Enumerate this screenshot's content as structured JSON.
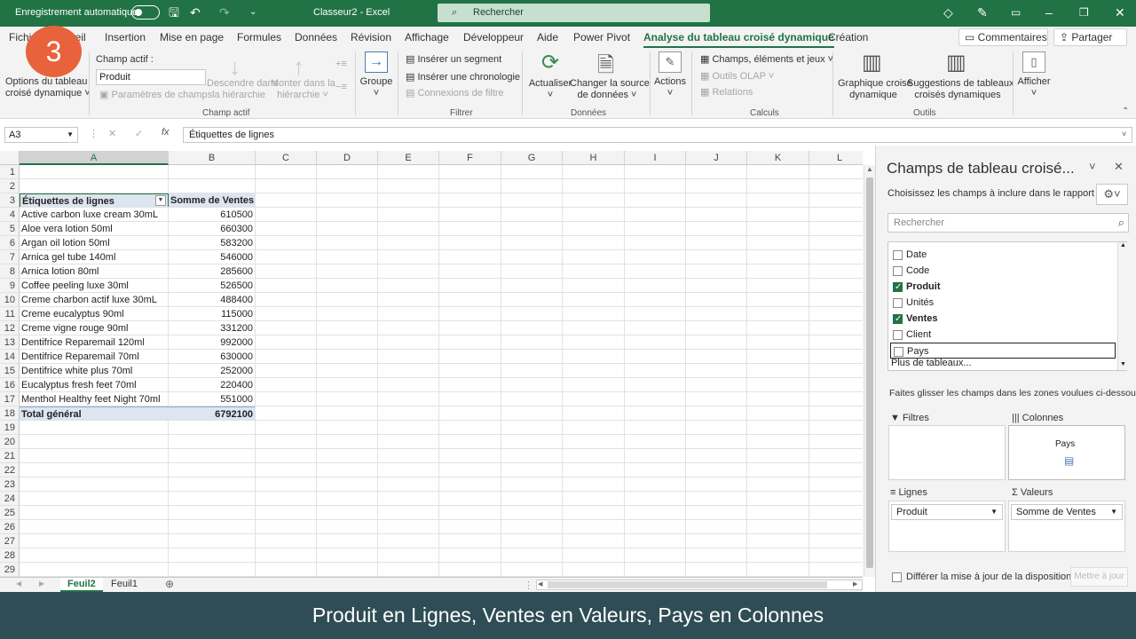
{
  "titlebar": {
    "autosave_label": "Enregistrement automatique",
    "doc_title": "Classeur2  -  Excel",
    "search_placeholder": "Rechercher"
  },
  "tabs": {
    "items": [
      "Fichier",
      "Accueil",
      "Insertion",
      "Mise en page",
      "Formules",
      "Données",
      "Révision",
      "Affichage",
      "Développeur",
      "Aide",
      "Power Pivot",
      "Analyse du tableau croisé dynamique",
      "Création"
    ],
    "fichier_visible": "Fichi",
    "accueil_visible": "ueil",
    "comments": "Commentaires",
    "share": "Partager"
  },
  "ribbon": {
    "options_line1": "Options du tableau",
    "options_line2": "croisé dynamique ˅",
    "active_field_label": "Champ actif :",
    "active_field_value": "Produit",
    "field_settings": "Paramètres de champs",
    "drill_down_1": "Descendre dans",
    "drill_down_2": "la hiérarchie",
    "drill_up_1": "Monter dans la",
    "drill_up_2": "hiérarchie ˅",
    "group_active_field": "Champ actif",
    "group_btn": "Groupe",
    "insert_slicer": "Insérer un segment",
    "insert_timeline": "Insérer une chronologie",
    "filter_connections": "Connexions de filtre",
    "group_filter": "Filtrer",
    "refresh": "Actualiser",
    "change_source_1": "Changer la source",
    "change_source_2": "de données ˅",
    "group_data": "Données",
    "actions": "Actions",
    "fields_items_sets": "Champs, éléments et jeux ˅",
    "olap_tools": "Outils OLAP ˅",
    "relations": "Relations",
    "group_calc": "Calculs",
    "pivot_chart_1": "Graphique croisé",
    "pivot_chart_2": "dynamique",
    "suggestions_1": "Suggestions de tableaux",
    "suggestions_2": "croisés dynamiques",
    "group_tools": "Outils",
    "show": "Afficher"
  },
  "badge": "3",
  "formula_bar": {
    "name_box": "A3",
    "content": "Étiquettes de lignes"
  },
  "grid": {
    "columns": [
      "A",
      "B",
      "C",
      "D",
      "E",
      "F",
      "G",
      "H",
      "I",
      "J",
      "K",
      "L"
    ],
    "header_a": "Étiquettes de lignes",
    "header_b": "Somme de Ventes",
    "rows": [
      {
        "label": "Active carbon luxe cream 30mL",
        "value": "610500"
      },
      {
        "label": "Aloe vera lotion 50ml",
        "value": "660300"
      },
      {
        "label": "Argan oil lotion 50ml",
        "value": "583200"
      },
      {
        "label": "Arnica gel tube 140ml",
        "value": "546000"
      },
      {
        "label": "Arnica lotion 80ml",
        "value": "285600"
      },
      {
        "label": "Coffee peeling luxe 30ml",
        "value": "526500"
      },
      {
        "label": "Creme charbon actif luxe 30mL",
        "value": "488400"
      },
      {
        "label": "Creme eucalyptus 90ml",
        "value": "115000"
      },
      {
        "label": "Creme vigne rouge 90ml",
        "value": "331200"
      },
      {
        "label": "Dentifrice Reparemail 120ml",
        "value": "992000"
      },
      {
        "label": "Dentifrice Reparemail 70ml",
        "value": "630000"
      },
      {
        "label": "Dentifrice white plus 70ml",
        "value": "252000"
      },
      {
        "label": "Eucalyptus fresh feet 70ml",
        "value": "220400"
      },
      {
        "label": "Menthol Healthy feet Night 70ml",
        "value": "551000"
      }
    ],
    "total_label": "Total général",
    "total_value": "6792100"
  },
  "sheets": [
    "Feuil2",
    "Feuil1"
  ],
  "pane": {
    "title": "Champs de tableau croisé...",
    "choose_label": "Choisissez les champs à inclure dans le rapport :",
    "search_placeholder": "Rechercher",
    "fields": [
      {
        "name": "Date",
        "checked": false
      },
      {
        "name": "Code",
        "checked": false
      },
      {
        "name": "Produit",
        "checked": true
      },
      {
        "name": "Unités",
        "checked": false
      },
      {
        "name": "Ventes",
        "checked": true
      },
      {
        "name": "Client",
        "checked": false
      },
      {
        "name": "Pays",
        "checked": false
      }
    ],
    "more_tables": "Plus de tableaux...",
    "drag_label": "Faites glisser les champs dans les zones voulues ci-dessous :",
    "zone_filters": "Filtres",
    "zone_columns": "Colonnes",
    "zone_columns_item": "Pays",
    "zone_rows": "Lignes",
    "zone_rows_item": "Produit",
    "zone_values": "Valeurs",
    "zone_values_item": "Somme de Ventes",
    "defer_label": "Différer la mise à jour de la disposition",
    "update_btn": "Mettre à jour"
  },
  "caption": "Produit en Lignes, Ventes en Valeurs, Pays en Colonnes",
  "colors": {
    "excel_green": "#217346",
    "caption_bg": "#2f4d55",
    "badge": "#e8623c"
  }
}
